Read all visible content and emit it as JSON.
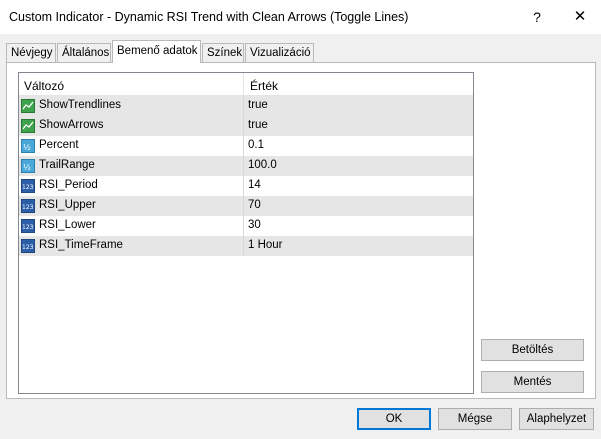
{
  "window": {
    "title": "Custom Indicator - Dynamic RSI Trend with Clean Arrows (Toggle Lines)",
    "help_glyph": "?",
    "close_glyph": "✕"
  },
  "tabs": [
    {
      "label": "Névjegy",
      "active": false
    },
    {
      "label": "Általános",
      "active": false
    },
    {
      "label": "Bemenő adatok",
      "active": true
    },
    {
      "label": "Színek",
      "active": false
    },
    {
      "label": "Vizualizáció",
      "active": false
    }
  ],
  "grid": {
    "col_variable": "Változó",
    "col_value": "Érték",
    "rows": [
      {
        "icon": "bool-icon",
        "name": "ShowTrendlines",
        "value": "true"
      },
      {
        "icon": "bool-icon",
        "name": "ShowArrows",
        "value": "true"
      },
      {
        "icon": "double-icon",
        "name": "Percent",
        "value": "0.1"
      },
      {
        "icon": "double-icon",
        "name": "TrailRange",
        "value": "100.0"
      },
      {
        "icon": "integer-icon",
        "name": "RSI_Period",
        "value": "14"
      },
      {
        "icon": "integer-icon",
        "name": "RSI_Upper",
        "value": "70"
      },
      {
        "icon": "integer-icon",
        "name": "RSI_Lower",
        "value": "30"
      },
      {
        "icon": "integer-icon",
        "name": "RSI_TimeFrame",
        "value": "1 Hour"
      }
    ]
  },
  "buttons": {
    "load": "Betöltés",
    "save": "Mentés",
    "ok": "OK",
    "cancel": "Mégse",
    "reset": "Alaphelyzet"
  }
}
